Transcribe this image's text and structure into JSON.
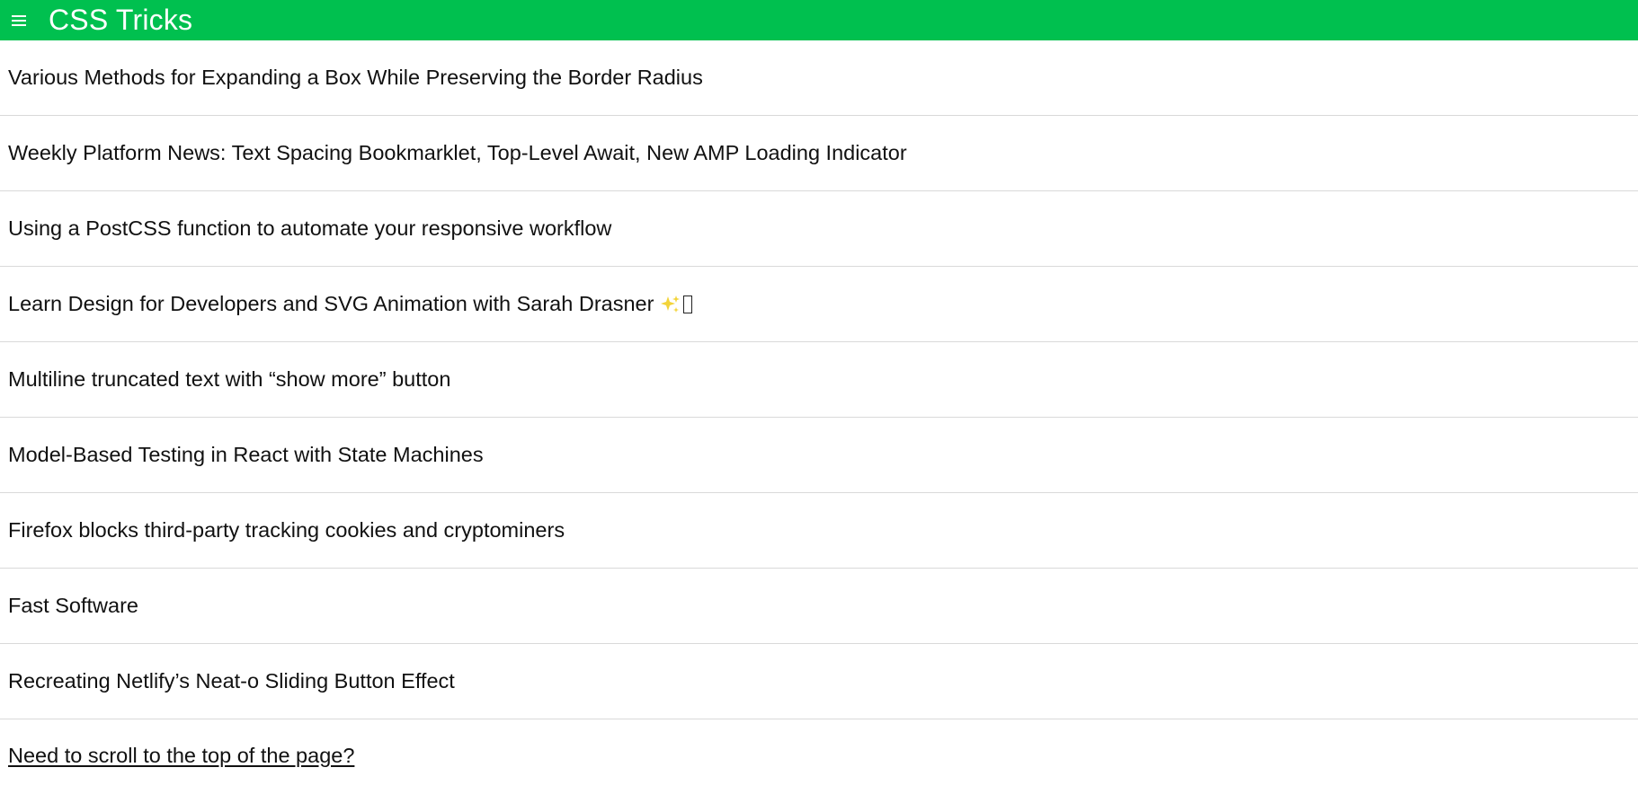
{
  "header": {
    "title": "CSS Tricks",
    "menu_icon": "hamburger-menu-icon",
    "background_color": "#00c04f"
  },
  "articles": [
    {
      "title": "Various Methods for Expanding a Box While Preserving the Border Radius"
    },
    {
      "title": "Weekly Platform News: Text Spacing Bookmarklet, Top-Level Await, New AMP Loading Indicator"
    },
    {
      "title": "Using a PostCSS function to automate your responsive workflow"
    },
    {
      "title": "Learn Design for Developers and SVG Animation with Sarah Drasner",
      "icons": [
        "sparkles-icon",
        "missing-glyph-icon"
      ]
    },
    {
      "title": "Multiline truncated text with “show more” button"
    },
    {
      "title": "Model-Based Testing in React with State Machines"
    },
    {
      "title": "Firefox blocks third-party tracking cookies and cryptominers"
    },
    {
      "title": "Fast Software"
    },
    {
      "title": "Recreating Netlify’s Neat-o Sliding Button Effect"
    }
  ],
  "footer": {
    "scroll_top_label": "Need to scroll to the top of the page?"
  }
}
